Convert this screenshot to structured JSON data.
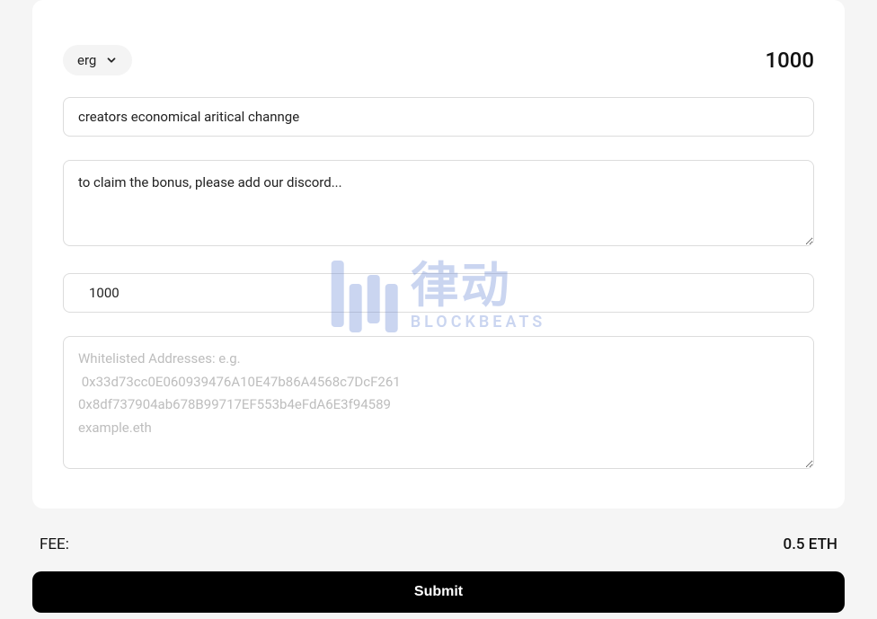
{
  "card": {
    "token_label": "erg",
    "balance": "1000",
    "title_input": "creators economical aritical channge",
    "description_input": "to claim the bonus, please add our discord...",
    "amount_input": "1000",
    "whitelist_placeholder": "Whitelisted Addresses: e.g.\n 0x33d73cc0E060939476A10E47b86A4568c7DcF261\n0x8df737904ab678B99717EF553b4eFdA6E3f94589\nexample.eth"
  },
  "fee": {
    "label": "FEE:",
    "value": "0.5 ETH"
  },
  "submit_label": "Submit",
  "watermark": {
    "cn": "律动",
    "en": "BLOCKBEATS"
  }
}
